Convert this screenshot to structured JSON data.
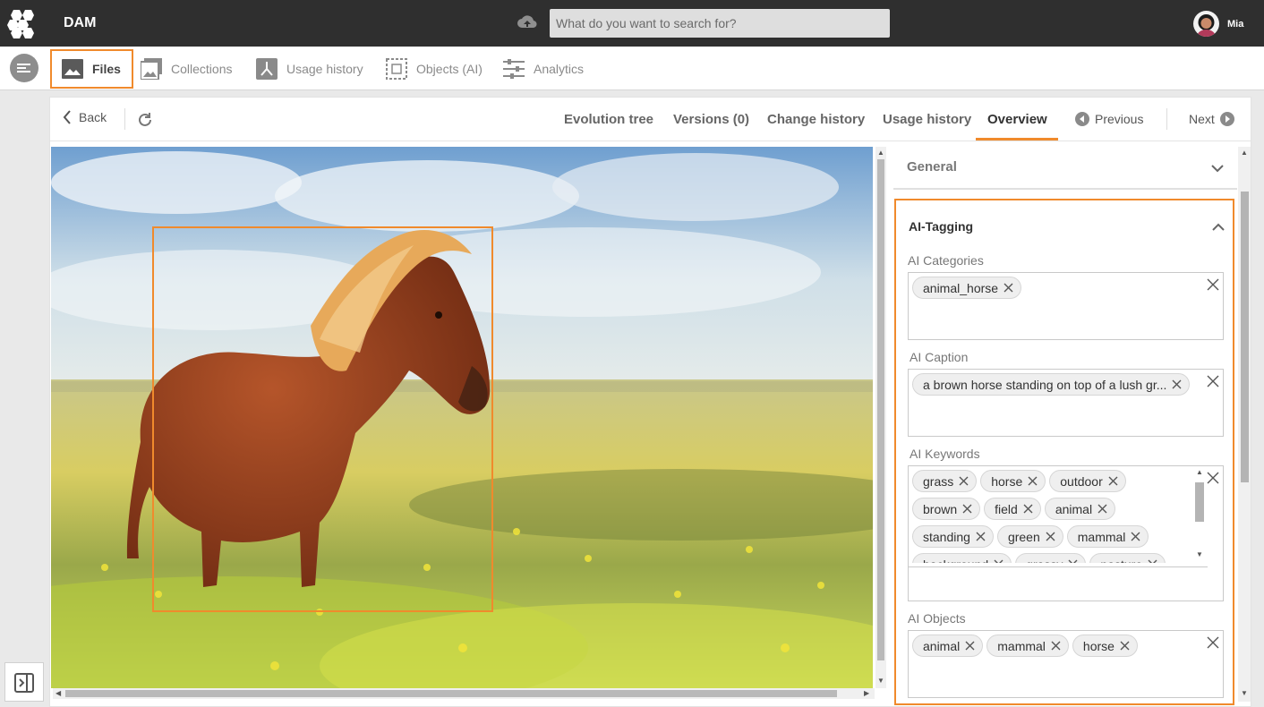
{
  "app": {
    "title": "DAM"
  },
  "search": {
    "placeholder": "What do you want to search for?"
  },
  "user": {
    "name": "Mia"
  },
  "nav": {
    "items": [
      {
        "label": "Files",
        "icon": "image-icon",
        "active": true
      },
      {
        "label": "Collections",
        "icon": "collections-icon"
      },
      {
        "label": "Usage history",
        "icon": "usage-icon"
      },
      {
        "label": "Objects (AI)",
        "icon": "objects-icon"
      },
      {
        "label": "Analytics",
        "icon": "sliders-icon"
      }
    ]
  },
  "toolbar": {
    "back": "Back",
    "tabs": [
      "Evolution tree",
      "Versions (0)",
      "Change history",
      "Usage history",
      "Overview"
    ],
    "active_tab": "Overview",
    "previous": "Previous",
    "next": "Next"
  },
  "panel": {
    "general_title": "General",
    "ai_title": "AI-Tagging",
    "categories": {
      "label": "AI Categories",
      "chips": [
        "animal_horse"
      ]
    },
    "caption": {
      "label": "AI Caption",
      "chips": [
        "a brown horse standing on top of a lush gr..."
      ]
    },
    "keywords": {
      "label": "AI Keywords",
      "chips": [
        "grass",
        "horse",
        "outdoor",
        "brown",
        "field",
        "animal",
        "standing",
        "green",
        "mammal",
        "background",
        "grassy",
        "pasture"
      ]
    },
    "objects": {
      "label": "AI Objects",
      "chips": [
        "animal",
        "mammal",
        "horse"
      ]
    }
  },
  "colors": {
    "accent": "#f08a2c",
    "topbar": "#2f2f2f"
  }
}
